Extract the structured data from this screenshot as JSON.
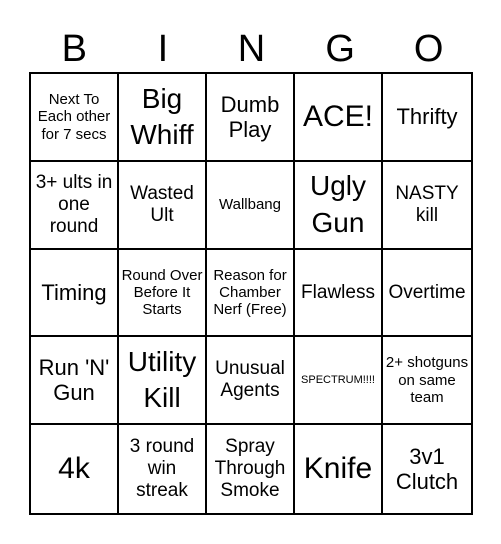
{
  "header": {
    "letters": [
      "B",
      "I",
      "N",
      "G",
      "O"
    ]
  },
  "cells": [
    {
      "text": "Next To Each other for 7 secs",
      "size": "sm"
    },
    {
      "text": "Big Whiff",
      "size": "xl"
    },
    {
      "text": "Dumb Play",
      "size": "lg"
    },
    {
      "text": "ACE!",
      "size": "xxl"
    },
    {
      "text": "Thrifty",
      "size": "lg"
    },
    {
      "text": "3+ ults in one round",
      "size": "md"
    },
    {
      "text": "Wasted Ult",
      "size": "md"
    },
    {
      "text": "Wallbang",
      "size": "sm"
    },
    {
      "text": "Ugly Gun",
      "size": "xl"
    },
    {
      "text": "NASTY kill",
      "size": "md"
    },
    {
      "text": "Timing",
      "size": "lg"
    },
    {
      "text": "Round Over Before It Starts",
      "size": "sm"
    },
    {
      "text": "Reason for Chamber Nerf (Free)",
      "size": "sm"
    },
    {
      "text": "Flawless",
      "size": "md"
    },
    {
      "text": "Overtime",
      "size": "md"
    },
    {
      "text": "Run 'N' Gun",
      "size": "lg"
    },
    {
      "text": "Utility Kill",
      "size": "xl"
    },
    {
      "text": "Unusual Agents",
      "size": "md"
    },
    {
      "text": "SPECTRUM!!!!",
      "size": "xs"
    },
    {
      "text": "2+ shotguns on same team",
      "size": "sm"
    },
    {
      "text": "4k",
      "size": "xxl"
    },
    {
      "text": "3 round win streak",
      "size": "md"
    },
    {
      "text": "Spray Through Smoke",
      "size": "md"
    },
    {
      "text": "Knife",
      "size": "xxl"
    },
    {
      "text": "3v1 Clutch",
      "size": "lg"
    }
  ]
}
